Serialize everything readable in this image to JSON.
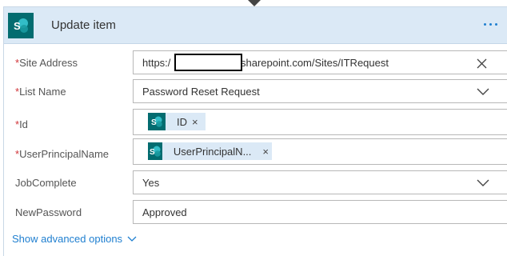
{
  "card": {
    "title": "Update item",
    "more_label": "More options"
  },
  "fields": {
    "site_address": {
      "label": "Site Address",
      "required_marker": "*",
      "value_prefix": "https:/",
      "value_suffix": "sharepoint.com/Sites/ITRequest"
    },
    "list_name": {
      "label": "List Name",
      "required_marker": "*",
      "value": "Password Reset Request"
    },
    "id": {
      "label": "Id",
      "required_marker": "*",
      "token_text": "ID",
      "token_close": "×"
    },
    "user_principal_name": {
      "label": "UserPrincipalName",
      "required_marker": "*",
      "token_text": "UserPrincipalN...",
      "token_close": "×"
    },
    "job_complete": {
      "label": "JobComplete",
      "value": "Yes"
    },
    "new_password": {
      "label": "NewPassword",
      "value": "Approved"
    }
  },
  "advanced": {
    "label": "Show advanced options"
  },
  "colors": {
    "header_bg": "#dbe9f6",
    "sharepoint_teal": "#036c70",
    "link_blue": "#1f7fd0",
    "required_red": "#d13438"
  },
  "icons": {
    "logo": "sharepoint-logo-icon",
    "clear": "close-icon",
    "dropdown": "chevron-down-icon",
    "more": "ellipsis-icon"
  }
}
